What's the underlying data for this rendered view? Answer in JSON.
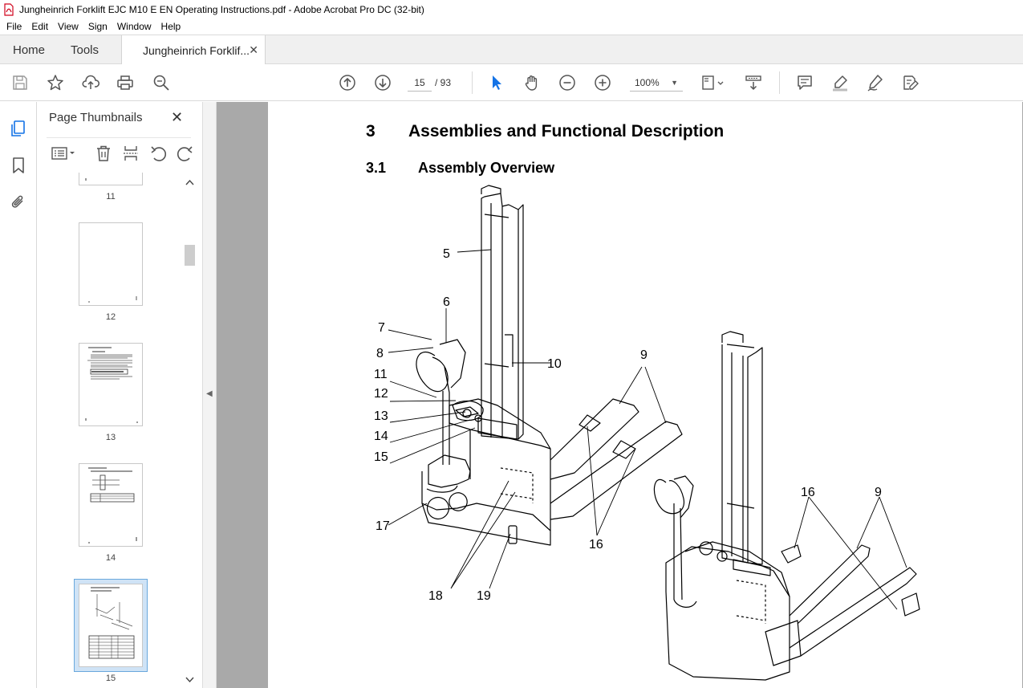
{
  "window": {
    "title": "Jungheinrich Forklift EJC M10 E EN Operating Instructions.pdf - Adobe Acrobat Pro DC (32-bit)"
  },
  "menu": [
    "File",
    "Edit",
    "View",
    "Sign",
    "Window",
    "Help"
  ],
  "tabs": {
    "home": "Home",
    "tools": "Tools",
    "document": "Jungheinrich Forklif...",
    "close": "✕"
  },
  "toolbar": {
    "icons": [
      "save-icon",
      "star-icon",
      "upload-icon",
      "print-icon",
      "search-icon",
      "page-up-icon",
      "page-down-icon",
      "select-arrow-icon",
      "hand-icon",
      "zoom-out-icon",
      "zoom-in-icon",
      "page-fit-icon",
      "scroll-mode-icon",
      "comment-icon",
      "highlight-icon",
      "draw-icon",
      "fill-sign-icon"
    ],
    "current_page": "15",
    "total_pages": "/ 93",
    "zoom": "100%"
  },
  "thumbnails": {
    "title": "Page Thumbnails",
    "close": "✕",
    "pages": [
      "11",
      "12",
      "13",
      "14",
      "15"
    ],
    "selected_page": "15"
  },
  "document": {
    "heading1_num": "3",
    "heading1": "Assemblies and Functional Description",
    "heading2_num": "3.1",
    "heading2": "Assembly Overview",
    "callouts": {
      "c5": "5",
      "c6": "6",
      "c7": "7",
      "c8": "8",
      "c9a": "9",
      "c10": "10",
      "c11": "11",
      "c12": "12",
      "c13": "13",
      "c14": "14",
      "c15": "15",
      "c16a": "16",
      "c17": "17",
      "c18": "18",
      "c19": "19",
      "c16b": "16",
      "c9b": "9"
    }
  },
  "colors": {
    "accent": "#1473e6",
    "doc_bg": "#a9a9a9",
    "selection": "#cfe3f6"
  }
}
